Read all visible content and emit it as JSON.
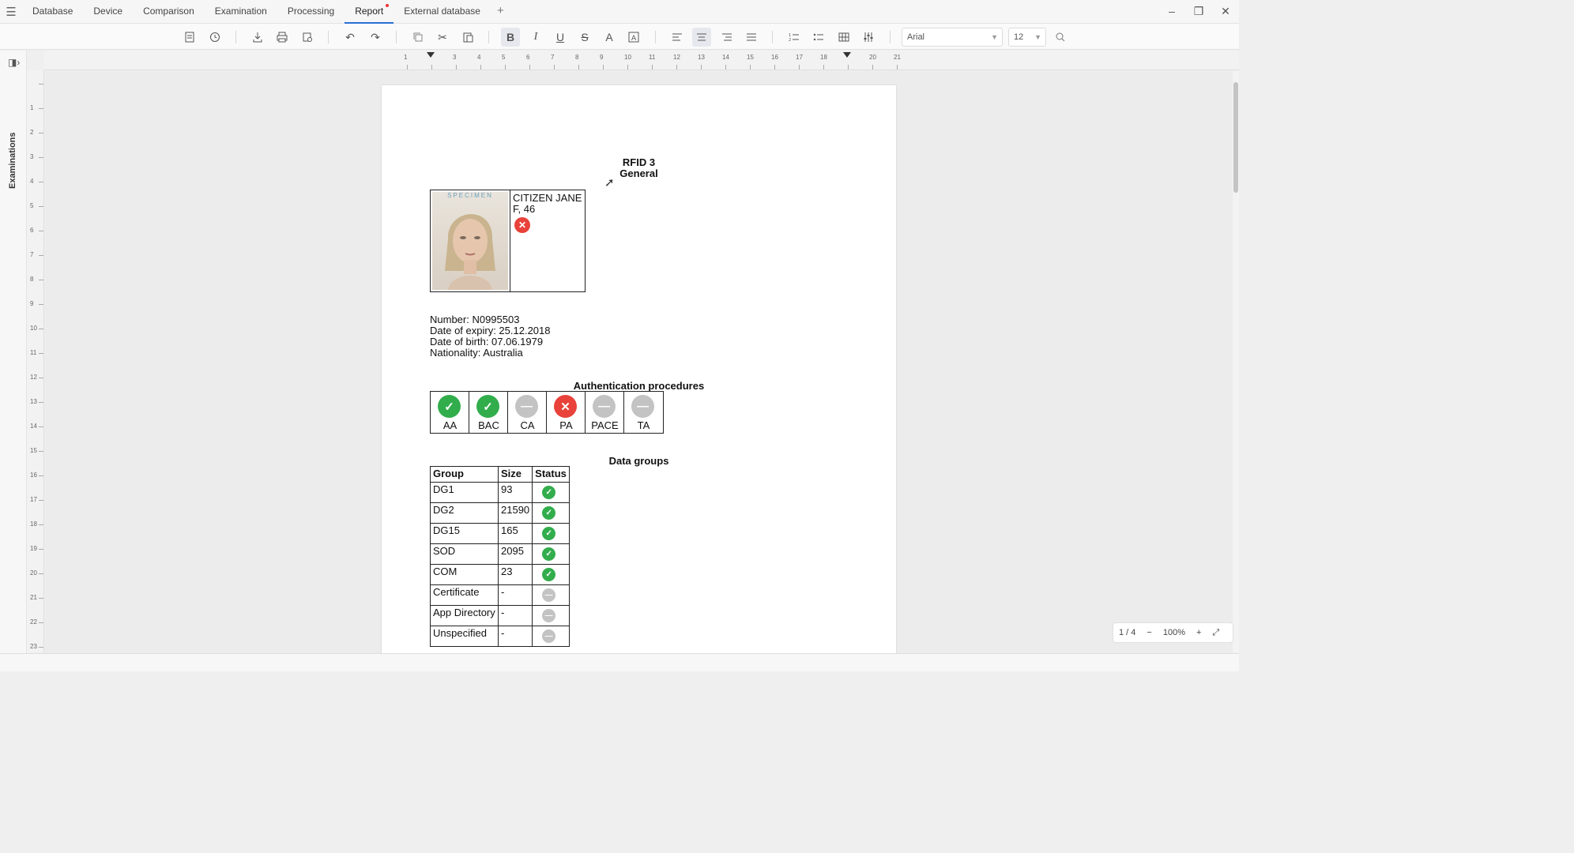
{
  "tabs": [
    {
      "label": "Database"
    },
    {
      "label": "Device"
    },
    {
      "label": "Comparison"
    },
    {
      "label": "Examination"
    },
    {
      "label": "Processing"
    },
    {
      "label": "Report",
      "active": true,
      "modified": true
    },
    {
      "label": "External database"
    }
  ],
  "add_tab": "+",
  "toolbar": {
    "font_family": "Arial",
    "font_size": "12",
    "active_buttons": [
      "bold-icon",
      "align-center-icon"
    ],
    "icons": [
      "document-icon",
      "history-icon",
      "download-icon",
      "print-icon",
      "print-preview-icon",
      "undo-icon",
      "redo-icon",
      "copy-icon",
      "cut-icon",
      "paste-icon",
      "bold-icon",
      "italic-icon",
      "underline-icon",
      "strikethrough-icon",
      "font-color-icon",
      "text-frame-icon",
      "align-left-icon",
      "align-center-icon",
      "align-right-icon",
      "justify-icon",
      "numbered-list-icon",
      "bullet-list-icon",
      "table-icon",
      "settings-sliders-icon",
      "search-icon"
    ]
  },
  "sidebar": {
    "label": "Examinations"
  },
  "ruler": {
    "h": [
      "1",
      "",
      "3",
      "4",
      "5",
      "6",
      "7",
      "8",
      "9",
      "10",
      "11",
      "12",
      "13",
      "14",
      "15",
      "16",
      "17",
      "18",
      "",
      "20",
      "21"
    ],
    "v": [
      "",
      "1",
      "2",
      "3",
      "4",
      "5",
      "6",
      "7",
      "8",
      "9",
      "10",
      "11",
      "12",
      "13",
      "14",
      "15",
      "16",
      "17",
      "18",
      "19",
      "20",
      "21",
      "22",
      "23"
    ]
  },
  "report": {
    "title": "RFID 3",
    "subtitle": "General",
    "photo_watermark": "SPECIMEN",
    "holder_name": "CITIZEN JANE",
    "holder_sex_age": "F, 46",
    "holder_status": "fail",
    "number": "Number: N0995503",
    "expiry": "Date of expiry: 25.12.2018",
    "birth": "Date of birth: 07.06.1979",
    "nationality": "Nationality: Australia",
    "auth_title": "Authentication procedures",
    "auth": [
      {
        "label": "AA",
        "status": "ok"
      },
      {
        "label": "BAC",
        "status": "ok"
      },
      {
        "label": "CA",
        "status": "na"
      },
      {
        "label": "PA",
        "status": "fail"
      },
      {
        "label": "PACE",
        "status": "na"
      },
      {
        "label": "TA",
        "status": "na"
      }
    ],
    "dg_title": "Data groups",
    "dg_headers": {
      "group": "Group",
      "size": "Size",
      "status": "Status"
    },
    "data_groups": [
      {
        "group": "DG1",
        "size": "93",
        "status": "ok"
      },
      {
        "group": "DG2",
        "size": "21590",
        "status": "ok"
      },
      {
        "group": "DG15",
        "size": "165",
        "status": "ok"
      },
      {
        "group": "SOD",
        "size": "2095",
        "status": "ok"
      },
      {
        "group": "COM",
        "size": "23",
        "status": "ok"
      },
      {
        "group": "Certificate",
        "size": "-",
        "status": "na"
      },
      {
        "group": "App Directory",
        "size": "-",
        "status": "na"
      },
      {
        "group": "Unspecified",
        "size": "-",
        "status": "na"
      }
    ]
  },
  "zoom": {
    "page": "1 / 4",
    "minus": "−",
    "level": "100%",
    "plus": "+"
  },
  "colors": {
    "ok": "#32ad4c",
    "fail": "#e8423a",
    "na": "#c3c3c3",
    "accent": "#2b6fd6"
  }
}
